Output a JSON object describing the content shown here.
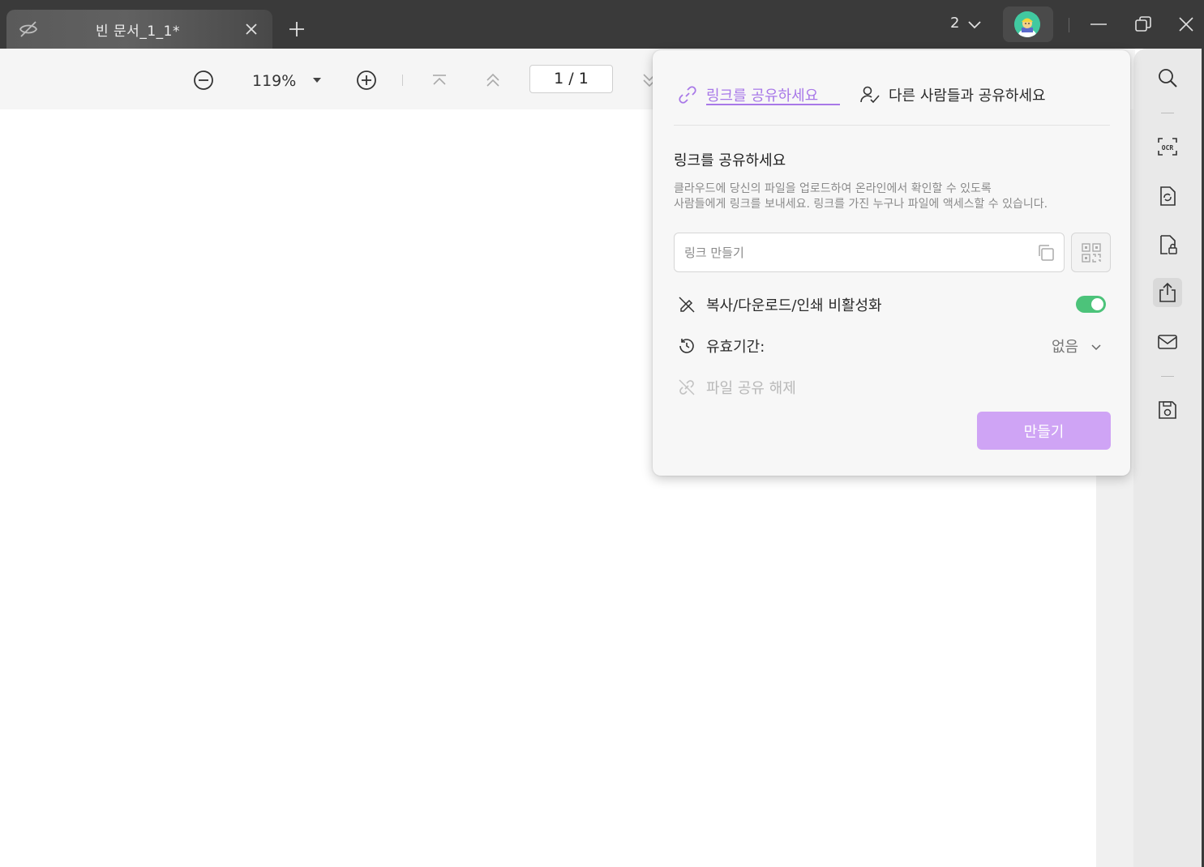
{
  "titlebar": {
    "tab_title": "빈 문서_1_1*",
    "window_count": "2",
    "colors": {
      "bar": "#3a3a3a",
      "avatar_bg": "#41c9a0"
    }
  },
  "toolbar": {
    "zoom_value": "119%",
    "page_indicator": "1 / 1"
  },
  "share_panel": {
    "tabs": [
      {
        "label": "링크를 공유하세요",
        "active": true
      },
      {
        "label": "다른 사람들과 공유하세요",
        "active": false
      }
    ],
    "heading": "링크를 공유하세요",
    "description_line1": "클라우드에 당신의 파일을 업로드하여 온라인에서 확인할 수 있도록",
    "description_line2": "사람들에게 링크를 보내세요. 링크를 가진 누구나 파일에 액세스할 수 있습니다.",
    "link_input": {
      "placeholder": "링크 만들기",
      "value": ""
    },
    "options": {
      "disable_copy_label": "복사/다운로드/인쇄 비활성화",
      "disable_copy_enabled": true,
      "expiry_label": "유효기간:",
      "expiry_value": "없음",
      "unshare_label": "파일 공유 해제"
    },
    "create_button_label": "만들기",
    "colors": {
      "accent": "#a878e8",
      "toggle_on": "#4cc37a",
      "create_button": "#cfa4f5"
    }
  },
  "sidebar": {
    "icons": [
      "search-icon",
      "ocr-icon",
      "convert-icon",
      "protect-icon",
      "share-icon",
      "email-icon",
      "save-icon"
    ],
    "active": "share-icon"
  }
}
